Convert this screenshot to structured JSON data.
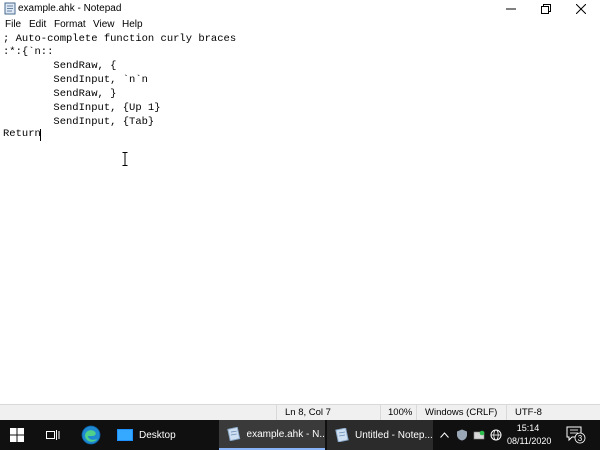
{
  "window": {
    "title": "example.ahk - Notepad"
  },
  "menu": {
    "file": "File",
    "edit": "Edit",
    "format": "Format",
    "view": "View",
    "help": "Help"
  },
  "editor": {
    "lines": [
      "; Auto-complete function curly braces",
      ":*:{`n::",
      "        SendRaw, {",
      "        SendInput, `n`n",
      "        SendRaw, }",
      "        SendInput, {Up 1}",
      "        SendInput, {Tab}",
      "Return"
    ]
  },
  "statusbar": {
    "position": "Ln 8, Col 7",
    "zoom": "100%",
    "line_endings": "Windows (CRLF)",
    "encoding": "UTF-8"
  },
  "taskbar": {
    "desktop_label": "Desktop",
    "windows": [
      {
        "label": "example.ahk - N..."
      },
      {
        "label": "Untitled - Notep..."
      }
    ],
    "clock_time": "15:14",
    "clock_date": "08/11/2020",
    "notification_count": "3"
  },
  "colors": {
    "taskbar_bg": "#101010",
    "taskbar_active": "#3a3a3a",
    "statusbar_bg": "#f0f0f0"
  }
}
